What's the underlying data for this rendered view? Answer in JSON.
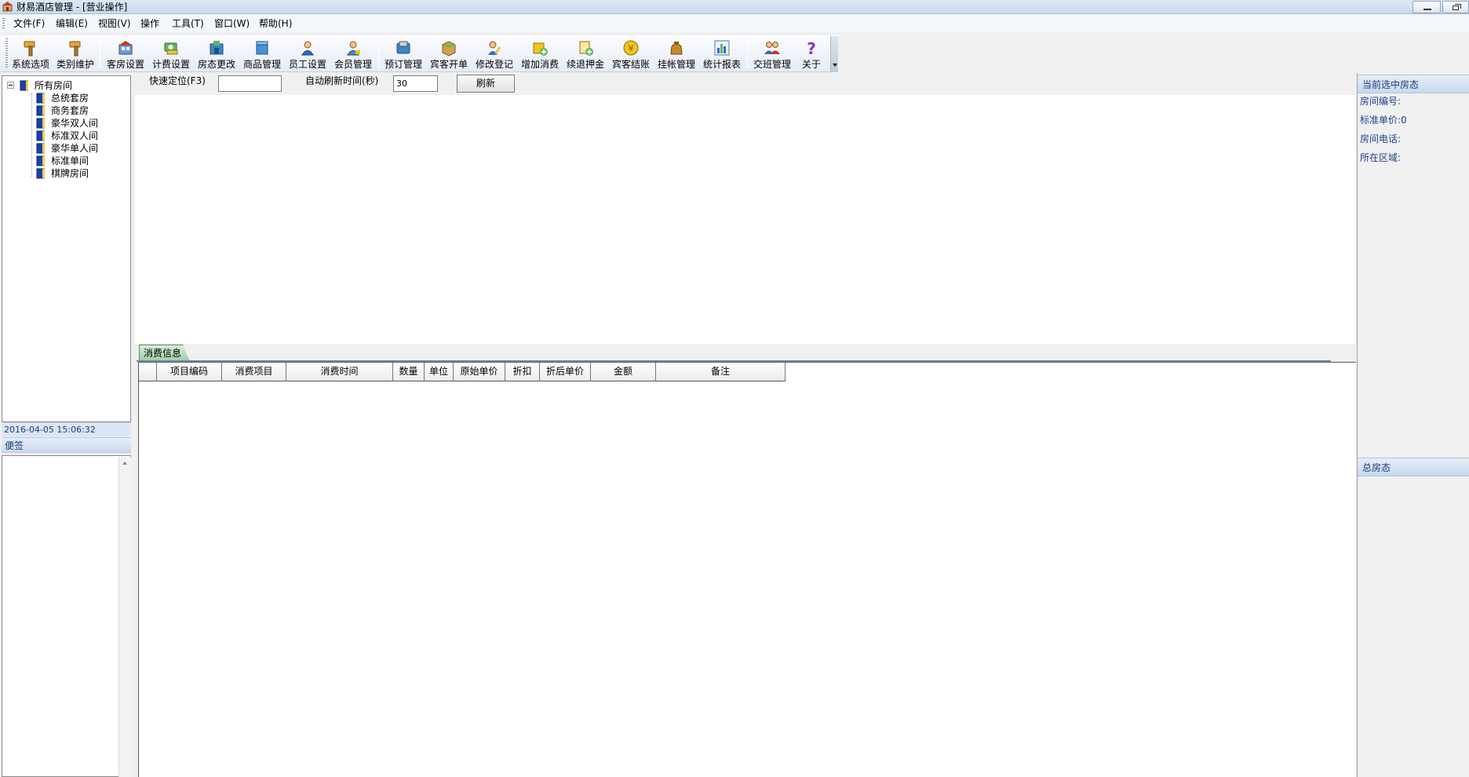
{
  "window": {
    "title": "财易酒店管理 - [营业操作]"
  },
  "menu": [
    {
      "label": "文件(F)"
    },
    {
      "label": "编辑(E)"
    },
    {
      "label": "视图(V)"
    },
    {
      "label": "操作"
    },
    {
      "label": "工具(T)"
    },
    {
      "label": "窗口(W)"
    },
    {
      "label": "帮助(H)"
    }
  ],
  "toolbar": [
    {
      "label": "系统选项",
      "icon": "hammer-icon"
    },
    {
      "label": "类别维护",
      "icon": "hammer-icon"
    },
    {
      "label": "客房设置",
      "icon": "room-settings-icon"
    },
    {
      "label": "计费设置",
      "icon": "money-settings-icon"
    },
    {
      "label": "房态更改",
      "icon": "room-status-icon"
    },
    {
      "label": "商品管理",
      "icon": "goods-icon"
    },
    {
      "label": "员工设置",
      "icon": "staff-icon"
    },
    {
      "label": "会员管理",
      "icon": "member-icon"
    },
    {
      "label": "预订管理",
      "icon": "booking-icon"
    },
    {
      "label": "宾客开单",
      "icon": "checkin-box-icon"
    },
    {
      "label": "修改登记",
      "icon": "edit-registration-icon"
    },
    {
      "label": "增加消费",
      "icon": "add-consumption-icon"
    },
    {
      "label": "续退押金",
      "icon": "deposit-icon"
    },
    {
      "label": "宾客结账",
      "icon": "checkout-coin-icon"
    },
    {
      "label": "挂帐管理",
      "icon": "credit-bag-icon"
    },
    {
      "label": "统计报表",
      "icon": "bar-chart-icon"
    },
    {
      "label": "交班管理",
      "icon": "shift-handover-icon"
    },
    {
      "label": "关于",
      "icon": "question-icon"
    }
  ],
  "tree": {
    "root": "所有房间",
    "children": [
      "总统套房",
      "商务套房",
      "豪华双人间",
      "标准双人间",
      "豪华单人间",
      "标准单间",
      "棋牌房间"
    ]
  },
  "datetime": "2016-04-05 15:06:32",
  "notes": {
    "title": "便签"
  },
  "search": {
    "label": "快速定位(F3)",
    "value": "",
    "refresh_label": "自动刷新时间(秒)",
    "refresh_value": "30",
    "refresh_button": "刷新"
  },
  "consumption": {
    "tab_label": "消费信息",
    "columns": [
      "项目编码",
      "消费项目",
      "消费时间",
      "数量",
      "单位",
      "原始单价",
      "折扣",
      "折后单价",
      "金额",
      "备注"
    ]
  },
  "right_panel": {
    "current_header": "当前选中房态",
    "room_no": "房间编号:",
    "std_price": "标准单价:0",
    "room_phone": "房间电话:",
    "area": "所在区域:",
    "total_header": "总房态"
  },
  "colors": {
    "tab_green": "#9fcfa8",
    "panel_text": "#1f3f8f"
  }
}
